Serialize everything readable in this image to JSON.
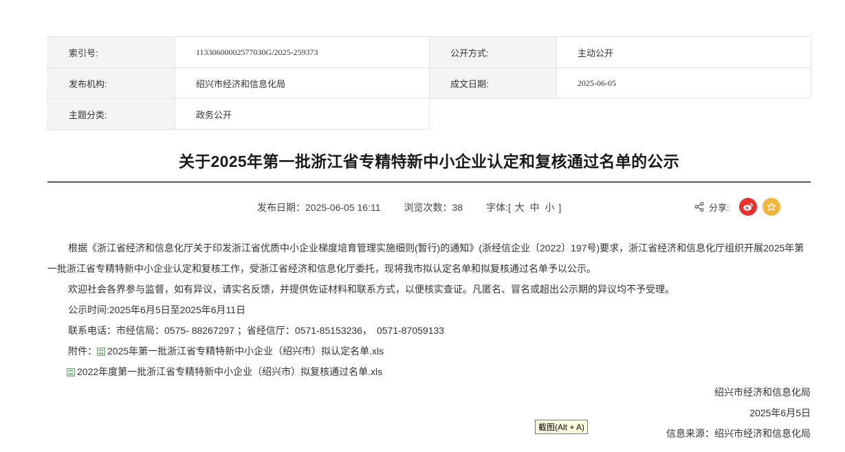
{
  "meta": {
    "index_no_label": "索引号:",
    "index_no_value": "11330600002577030G/2025-259373",
    "disclosure_label": "公开方式:",
    "disclosure_value": "主动公开",
    "publisher_label": "发布机构:",
    "publisher_value": "绍兴市经济和信息化局",
    "created_date_label": "成文日期:",
    "created_date_value": "2025-06-05",
    "topic_label": "主题分类:",
    "topic_value": "政务公开"
  },
  "article": {
    "title": "关于2025年第一批浙江省专精特新中小企业认定和复核通过名单的公示",
    "publish_date": "发布日期：2025-06-05 16:11",
    "views": "浏览次数：38",
    "font_label": "字体:[",
    "font_large": "大",
    "font_medium": "中",
    "font_small": "小",
    "font_end": "]",
    "share_label": "分享:",
    "paragraph1": "根据《浙江省经济和信息化厅关于印发浙江省优质中小企业梯度培育管理实施细则(暂行)的通知》(浙经信企业〔2022〕197号)要求，浙江省经济和信息化厅组织开展2025年第一批浙江省专精特新中小企业认定和复核工作，受浙江省经济和信息化厅委托，现将我市拟认定名单和拟复核通过名单予以公示。",
    "paragraph2": "欢迎社会各界参与监督，如有异议，请实名反馈，并提供佐证材料和联系方式，以便核实查证。凡匿名、冒名或超出公示期的异议均不予受理。",
    "paragraph3": "公示时间:2025年6月5日至2025年6月11日",
    "paragraph4": "联系电话：市经信局：0575- 88267297 ；省经信厅：0571-85153236，　0571-87059133",
    "attachment_label": "附件：",
    "attachment1": "2025年第一批浙江省专精特新中小企业（绍兴市）拟认定名单.xls",
    "attachment2": "2022年度第一批浙江省专精特新中小企业（绍兴市）拟复核通过名单.xls",
    "signature_org": "绍兴市经济和信息化局",
    "signature_date": "2025年6月5日",
    "source": "信息来源：绍兴市经济和信息化局"
  },
  "tooltip": {
    "text": "截图(Alt + A)"
  },
  "colors": {
    "weibo": "#e6312f",
    "favorite": "#f2b53b",
    "divider": "#555555"
  },
  "icons": {
    "share": "share-icon",
    "weibo": "weibo-icon",
    "favorite": "star-icon",
    "attachment": "xls-file-icon"
  }
}
